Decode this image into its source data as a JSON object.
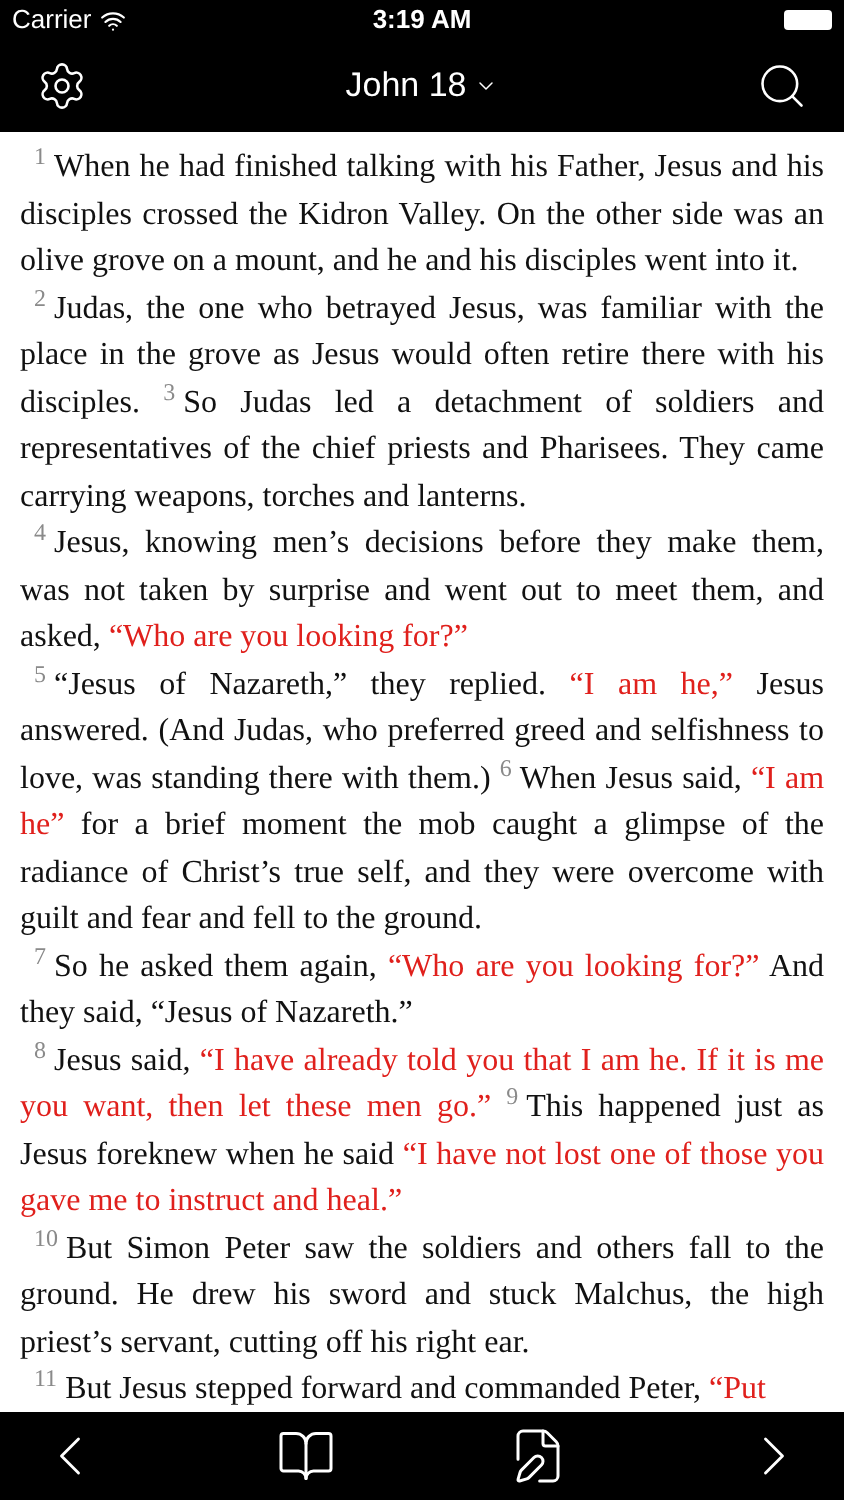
{
  "status_bar": {
    "carrier": "Carrier",
    "time": "3:19 AM"
  },
  "nav_bar": {
    "title": "John 18"
  },
  "paragraphs": [
    {
      "verses": [
        {
          "number": "1",
          "segments": [
            {
              "kind": "narration",
              "text": "When he had finished talking with his Father, Jesus and his disciples crossed the Kidron Valley. On the other side was an olive grove on a mount, and he and his disciples went into it."
            }
          ]
        }
      ]
    },
    {
      "verses": [
        {
          "number": "2",
          "segments": [
            {
              "kind": "narration",
              "text": "Judas, the one who betrayed Jesus, was familiar with the place in the grove as Jesus would often retire there with his disciples."
            }
          ]
        },
        {
          "number": "3",
          "segments": [
            {
              "kind": "narration",
              "text": "So Judas led a detachment of soldiers and representatives of the chief priests and Pharisees. They came carrying weapons, torches and lanterns."
            }
          ]
        }
      ]
    },
    {
      "verses": [
        {
          "number": "4",
          "segments": [
            {
              "kind": "narration",
              "text": "Jesus, knowing men’s decisions before they make them, was not taken by surprise and went out to meet them, and asked,"
            },
            {
              "kind": "jesus",
              "text": "“Who are you looking for?”"
            }
          ]
        }
      ]
    },
    {
      "verses": [
        {
          "number": "5",
          "segments": [
            {
              "kind": "narration",
              "text": "“Jesus of Nazareth,” they replied."
            },
            {
              "kind": "jesus",
              "text": "“I am he,”"
            },
            {
              "kind": "narration",
              "text": "Jesus answered. (And Judas, who preferred greed and selfishness to love, was standing there with them.)"
            }
          ]
        },
        {
          "number": "6",
          "segments": [
            {
              "kind": "narration",
              "text": "When Jesus said,"
            },
            {
              "kind": "jesus",
              "text": "“I am he”"
            },
            {
              "kind": "narration",
              "text": "for a brief moment the mob caught a glimpse of the radiance of Christ’s true self, and they were overcome with guilt and fear and fell to the ground."
            }
          ]
        }
      ]
    },
    {
      "verses": [
        {
          "number": "7",
          "segments": [
            {
              "kind": "narration",
              "text": "So he asked them again,"
            },
            {
              "kind": "jesus",
              "text": "“Who are you looking for?”"
            },
            {
              "kind": "narration",
              "text": "And they said, “Jesus of Nazareth.”"
            }
          ]
        }
      ]
    },
    {
      "verses": [
        {
          "number": "8",
          "segments": [
            {
              "kind": "narration",
              "text": "Jesus said,"
            },
            {
              "kind": "jesus",
              "text": "“I have already told you that I am he. If it is me you want, then let these men go.”"
            }
          ]
        },
        {
          "number": "9",
          "segments": [
            {
              "kind": "narration",
              "text": "This happened just as Jesus foreknew when he said"
            },
            {
              "kind": "jesus",
              "text": "“I have not lost one of those you gave me to instruct and heal.”"
            }
          ]
        }
      ]
    },
    {
      "verses": [
        {
          "number": "10",
          "segments": [
            {
              "kind": "narration",
              "text": "But Simon Peter saw the soldiers and others fall to the ground. He drew his sword and stuck Malchus, the high priest’s servant, cutting off his right ear."
            }
          ]
        }
      ]
    },
    {
      "verses": [
        {
          "number": "11",
          "segments": [
            {
              "kind": "narration",
              "text": "But Jesus stepped forward and commanded Peter,"
            },
            {
              "kind": "jesus",
              "text": "“Put"
            }
          ]
        }
      ]
    }
  ]
}
